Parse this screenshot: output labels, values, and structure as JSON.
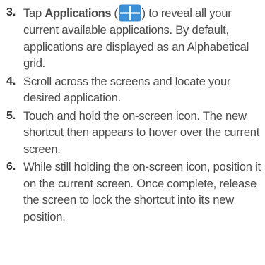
{
  "steps": [
    {
      "number": "3.",
      "pre": "Tap ",
      "bold": "Applications",
      "open_paren": " (",
      "icon": "applications-grid-icon",
      "close_paren": ")",
      "post": " to reveal all your current available applications. By default, applications are displayed as an Alphabetical grid."
    },
    {
      "number": "4.",
      "text": "Scroll across the screens and locate your desired application."
    },
    {
      "number": "5.",
      "text": "Touch and hold the on-screen icon. The new shortcut then appears to hover over the current screen."
    },
    {
      "number": "6.",
      "text": "While still holding the on-screen icon, position it on the current screen. Once complete, release the screen to lock the shortcut into its new position."
    }
  ],
  "colors": {
    "text": "#4a4a4a",
    "number": "#333333",
    "icon_fill": "#3b8fd6",
    "icon_lines": "#ffffff"
  }
}
